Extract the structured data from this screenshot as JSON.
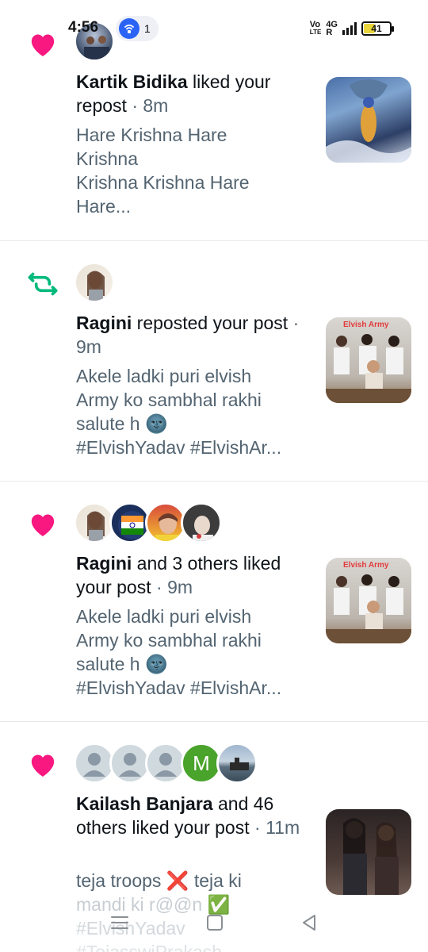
{
  "status_bar": {
    "time": "4:56",
    "hotspot_count": "1",
    "network_label_top": "Vo",
    "network_label_bottom": "LTE",
    "signal_label_top": "4G",
    "signal_label_bottom": "R",
    "battery_level": "41"
  },
  "notifications": [
    {
      "type": "like",
      "user": "Kartik Bidika",
      "action": " liked your repost",
      "time": "8m",
      "preview_lines": [
        "Hare Krishna Hare",
        "Krishna",
        "Krishna Krishna Hare",
        "Hare..."
      ]
    },
    {
      "type": "repost",
      "user": "Ragini",
      "action": " reposted your post",
      "time": "9m",
      "preview_lines": [
        "Akele ladki puri elvish",
        "Army ko sambhal rakhi",
        "salute h 🌚",
        "#ElvishYadav #ElvishAr..."
      ],
      "thumb_caption": "Elvish Army"
    },
    {
      "type": "like",
      "user": "Ragini",
      "action": " and 3 others liked your post",
      "time": "9m",
      "preview_lines": [
        "Akele ladki puri elvish",
        "Army ko sambhal rakhi",
        "salute h 🌚",
        "#ElvishYadav #ElvishAr..."
      ],
      "thumb_caption": "Elvish Army"
    },
    {
      "type": "like",
      "user": "Kailash Banjara",
      "action": " and 46 others liked your post",
      "time": "11m",
      "avatar_letter": "M",
      "preview_lines": [
        "teja troops ❌ teja ki",
        "mandi ki r@@n ✅",
        "#ElvishYadav",
        "#TejasswiPrakash"
      ]
    }
  ],
  "colors": {
    "like": "#f91880",
    "repost": "#00ba7c",
    "secondary_text": "#536471",
    "divider": "#e6e9ec"
  }
}
